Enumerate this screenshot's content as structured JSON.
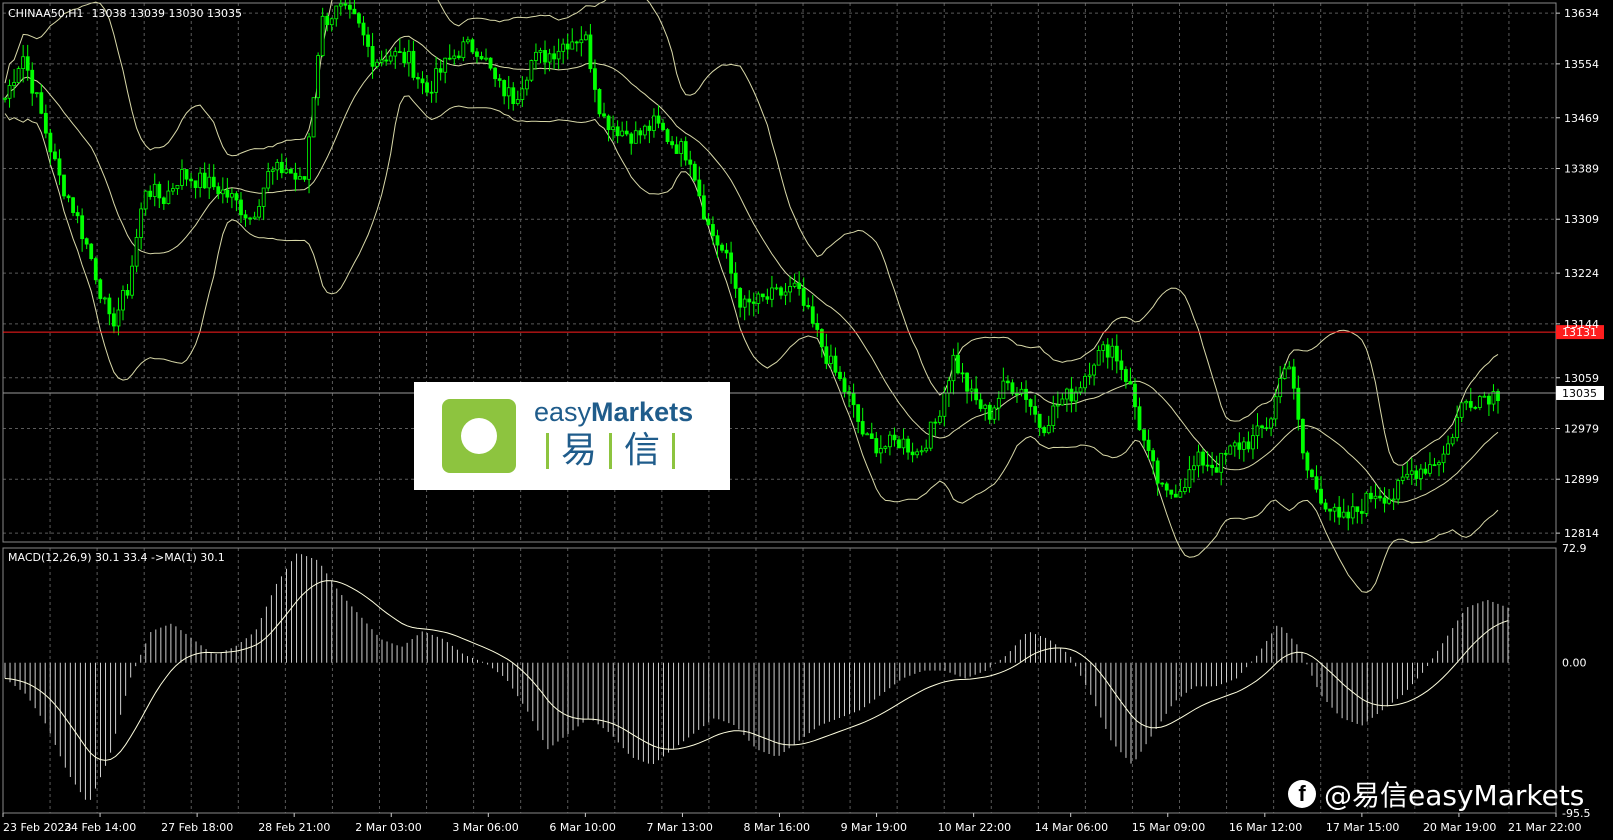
{
  "header": {
    "symbol": "CHINAA50,H1",
    "ohlc": "13038 13039 13030 13035"
  },
  "colors": {
    "background": "#000000",
    "grid": "#5a5a5a",
    "candle": "#00ff00",
    "bands": "#d8d8a8",
    "resistance": "#ff1e1e",
    "macd_hist": "#cfcfcf",
    "signal": "#ffffe0"
  },
  "chart_data": [
    {
      "type": "line",
      "title": "CHINAA50,H1",
      "ohlc_readout": "13038 13039 13030 13035",
      "indicator": "Bollinger Bands",
      "x_labels": [
        "23 Feb 2023",
        "24 Feb 14:00",
        "27 Feb 18:00",
        "28 Feb 21:00",
        "2 Mar 03:00",
        "3 Mar 06:00",
        "6 Mar 10:00",
        "7 Mar 13:00",
        "8 Mar 16:00",
        "9 Mar 19:00",
        "10 Mar 22:00",
        "14 Mar 06:00",
        "15 Mar 09:00",
        "16 Mar 12:00",
        "17 Mar 15:00",
        "20 Mar 19:00",
        "21 Mar 22:00"
      ],
      "y_ticks": [
        "13634",
        "13554",
        "13469",
        "13389",
        "13309",
        "13224",
        "13144",
        "13059",
        "12979",
        "12899",
        "12814"
      ],
      "ylim": [
        12800,
        13650
      ],
      "price_path": [
        13500,
        13570,
        13480,
        13380,
        13320,
        13240,
        13140,
        13200,
        13360,
        13340,
        13380,
        13370,
        13360,
        13340,
        13310,
        13380,
        13390,
        13360,
        13620,
        13640,
        13620,
        13560,
        13570,
        13560,
        13510,
        13550,
        13580,
        13580,
        13520,
        13500,
        13560,
        13570,
        13590,
        13600,
        13470,
        13450,
        13440,
        13460,
        13430,
        13410,
        13300,
        13250,
        13170,
        13180,
        13190,
        13200,
        13140,
        13080,
        13030,
        12960,
        12950,
        12960,
        12940,
        12990,
        13090,
        13030,
        13000,
        13050,
        13040,
        12980,
        13020,
        13040,
        13090,
        13110,
        13050,
        12940,
        12870,
        12890,
        12930,
        12920,
        12950,
        12960,
        12990,
        13100,
        12920,
        12870,
        12830,
        12850,
        12880,
        12870,
        12910,
        12920,
        12940,
        13020,
        13030,
        13035
      ],
      "resistance_line": {
        "value": 13131,
        "label": "13131"
      },
      "current_price": {
        "value": 13035,
        "label": "13035"
      }
    },
    {
      "type": "bar",
      "title": "MACD(12,26,9) 30.1 33.4  ->MA(1) 30.1",
      "indicator": "MACD",
      "y_ticks": [
        "72.9",
        "0.00",
        "-95.5"
      ],
      "ylim": [
        -95.5,
        72.9
      ],
      "hist_path": [
        -10,
        -20,
        -40,
        -70,
        -90,
        -60,
        -10,
        20,
        25,
        15,
        5,
        10,
        20,
        50,
        70,
        65,
        45,
        30,
        15,
        10,
        20,
        15,
        5,
        0,
        -10,
        -30,
        -55,
        -45,
        -35,
        -45,
        -60,
        -65,
        -55,
        -45,
        -35,
        -40,
        -55,
        -60,
        -50,
        -40,
        -35,
        -30,
        -20,
        -10,
        -5,
        -5,
        -10,
        -5,
        5,
        20,
        15,
        5,
        -20,
        -50,
        -65,
        -45,
        -25,
        -15,
        -15,
        -10,
        5,
        25,
        10,
        -20,
        -35,
        -40,
        -30,
        -20,
        -5,
        15,
        35,
        40,
        35
      ]
    }
  ],
  "logo": {
    "brand_en_light": "easy",
    "brand_en_bold": "Markets",
    "brand_cn_1": "易",
    "brand_cn_2": "信"
  },
  "watermark": {
    "fb_icon": "f",
    "text": "@易信easyMarkets"
  }
}
